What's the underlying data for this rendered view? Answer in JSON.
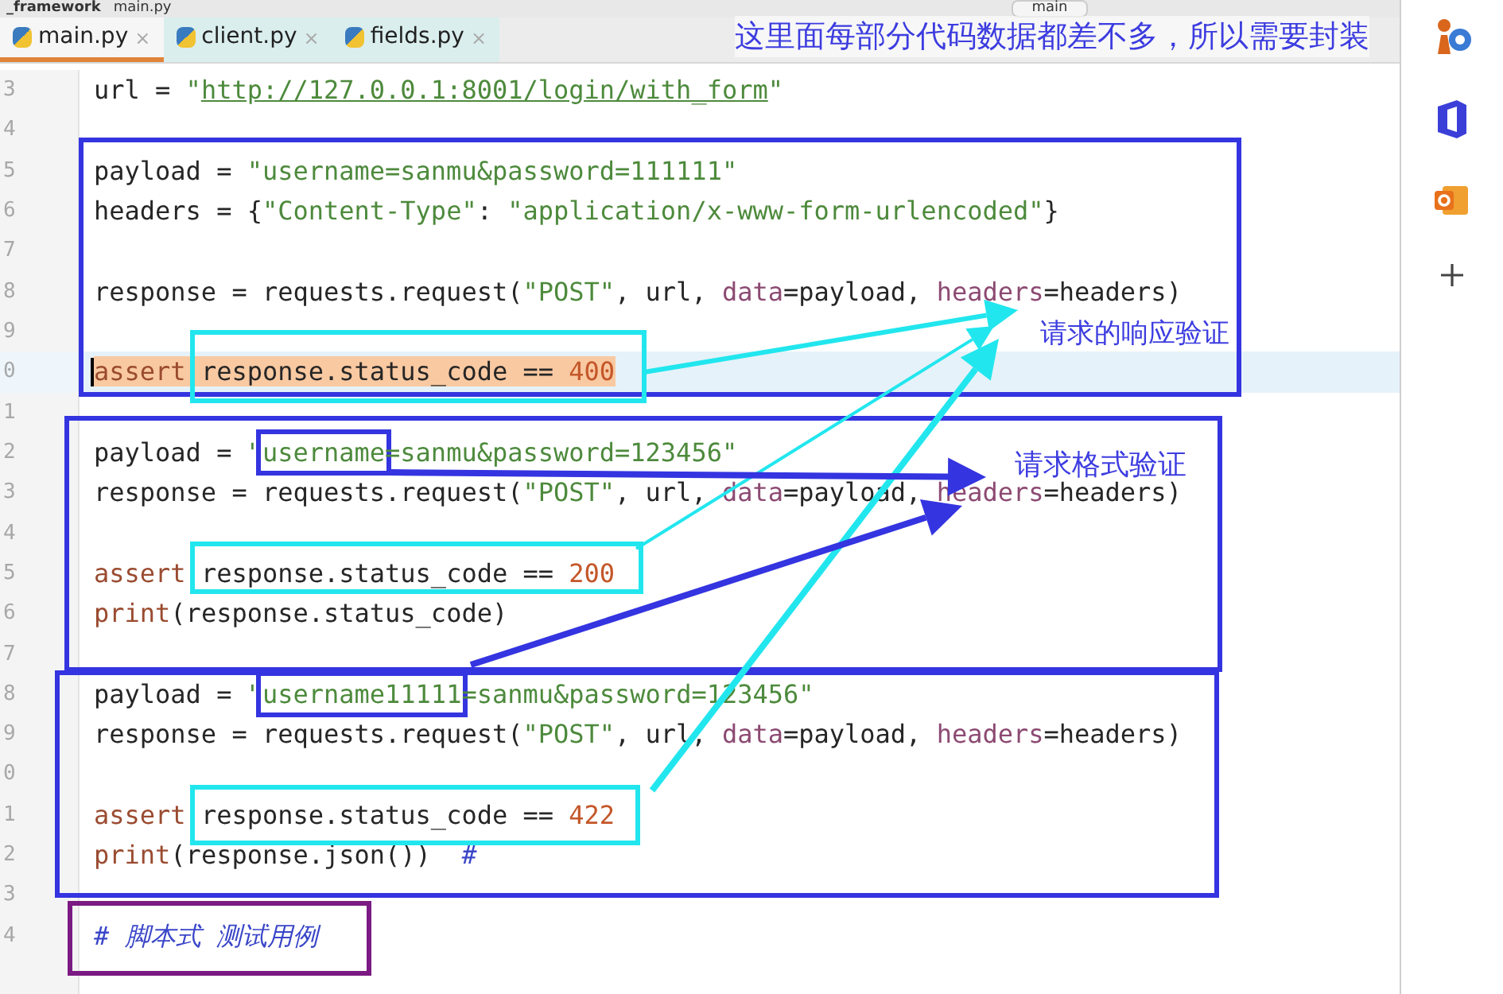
{
  "breadcrumb": [
    "_framework",
    "main.py"
  ],
  "toolbar": {
    "branch": "main"
  },
  "tabs": [
    {
      "label": "main.py",
      "close": "×",
      "selected": true
    },
    {
      "label": "client.py",
      "close": "×",
      "selected": false
    },
    {
      "label": "fields.py",
      "close": "×",
      "selected": false
    }
  ],
  "code_lines": [
    {
      "number": "3",
      "highlighted": false,
      "tokens": [
        {
          "kind": "plain",
          "text": "url = "
        },
        {
          "kind": "string",
          "text": "\""
        },
        {
          "kind": "url",
          "text": "http://127.0.0.1:8001/login/with_form"
        },
        {
          "kind": "string",
          "text": "\""
        }
      ]
    },
    {
      "number": "4",
      "highlighted": false
    },
    {
      "number": "5",
      "highlighted": false,
      "tokens": [
        {
          "kind": "plain",
          "text": "payload = "
        },
        {
          "kind": "string",
          "text": "\"username=sanmu&password=111111\""
        }
      ]
    },
    {
      "number": "6",
      "highlighted": false,
      "tokens": [
        {
          "kind": "plain",
          "text": "headers = {"
        },
        {
          "kind": "string",
          "text": "\"Content-Type\""
        },
        {
          "kind": "plain",
          "text": ": "
        },
        {
          "kind": "string",
          "text": "\"application/x-www-form-urlencoded\""
        },
        {
          "kind": "plain",
          "text": "}"
        }
      ]
    },
    {
      "number": "7",
      "highlighted": false
    },
    {
      "number": "8",
      "highlighted": false,
      "tokens": [
        {
          "kind": "plain",
          "text": "response = requests.request("
        },
        {
          "kind": "string",
          "text": "\"POST\""
        },
        {
          "kind": "plain",
          "text": ", url, "
        },
        {
          "kind": "param",
          "text": "data"
        },
        {
          "kind": "plain",
          "text": "=payload, "
        },
        {
          "kind": "param",
          "text": "headers"
        },
        {
          "kind": "plain",
          "text": "=headers)"
        }
      ]
    },
    {
      "number": "9",
      "highlighted": false
    },
    {
      "number": "0",
      "highlighted": true,
      "tokens": [
        {
          "kind": "keyword",
          "text": "assert "
        },
        {
          "kind": "plain",
          "text": "response.status_code == "
        },
        {
          "kind": "number",
          "text": "400"
        }
      ]
    },
    {
      "number": "1",
      "highlighted": false
    },
    {
      "number": "2",
      "highlighted": false,
      "tokens": [
        {
          "kind": "plain",
          "text": "payload = "
        },
        {
          "kind": "string",
          "text": "\""
        },
        {
          "kind": "string",
          "text": "username",
          "framed": true
        },
        {
          "kind": "string",
          "text": "=sanmu&password=123456\""
        }
      ]
    },
    {
      "number": "3",
      "highlighted": false,
      "tokens": [
        {
          "kind": "plain",
          "text": "response = requests.request("
        },
        {
          "kind": "string",
          "text": "\"POST\""
        },
        {
          "kind": "plain",
          "text": ", url, "
        },
        {
          "kind": "param",
          "text": "data"
        },
        {
          "kind": "plain",
          "text": "=payload, "
        },
        {
          "kind": "param",
          "text": "headers"
        },
        {
          "kind": "plain",
          "text": "=headers)"
        }
      ]
    },
    {
      "number": "4",
      "highlighted": false
    },
    {
      "number": "5",
      "highlighted": false,
      "tokens": [
        {
          "kind": "keyword",
          "text": "assert "
        },
        {
          "kind": "plain",
          "text": "response.status_code == "
        },
        {
          "kind": "number",
          "text": "200"
        }
      ]
    },
    {
      "number": "6",
      "highlighted": false,
      "tokens": [
        {
          "kind": "keyword",
          "text": "print"
        },
        {
          "kind": "plain",
          "text": "(response.status_code)"
        }
      ]
    },
    {
      "number": "7",
      "highlighted": false
    },
    {
      "number": "8",
      "highlighted": false,
      "tokens": [
        {
          "kind": "plain",
          "text": "payload = "
        },
        {
          "kind": "string",
          "text": "\""
        },
        {
          "kind": "string",
          "text": "username11111",
          "framed": true
        },
        {
          "kind": "string",
          "text": "=sanmu&password=123456\""
        }
      ]
    },
    {
      "number": "9",
      "highlighted": false,
      "tokens": [
        {
          "kind": "plain",
          "text": "response = requests.request("
        },
        {
          "kind": "string",
          "text": "\"POST\""
        },
        {
          "kind": "plain",
          "text": ", url, "
        },
        {
          "kind": "param",
          "text": "data"
        },
        {
          "kind": "plain",
          "text": "=payload, "
        },
        {
          "kind": "param",
          "text": "headers"
        },
        {
          "kind": "plain",
          "text": "=headers)"
        }
      ]
    },
    {
      "number": "0",
      "highlighted": false
    },
    {
      "number": "1",
      "highlighted": false,
      "tokens": [
        {
          "kind": "keyword",
          "text": "assert "
        },
        {
          "kind": "plain",
          "text": "response.status_code == "
        },
        {
          "kind": "number",
          "text": "422"
        }
      ]
    },
    {
      "number": "2",
      "highlighted": false,
      "tokens": [
        {
          "kind": "keyword",
          "text": "print"
        },
        {
          "kind": "plain",
          "text": "(response.json())  "
        },
        {
          "kind": "comment",
          "text": "#"
        }
      ]
    },
    {
      "number": "3",
      "highlighted": false
    },
    {
      "number": "4",
      "highlighted": false,
      "tokens": [
        {
          "kind": "comment",
          "text": "# 脚本式 测试用例"
        }
      ]
    }
  ],
  "annotations": {
    "title": "这里面每部分代码数据都差不多，所以需要封装",
    "labels": [
      "请求的响应验证",
      "请求格式验证"
    ]
  }
}
